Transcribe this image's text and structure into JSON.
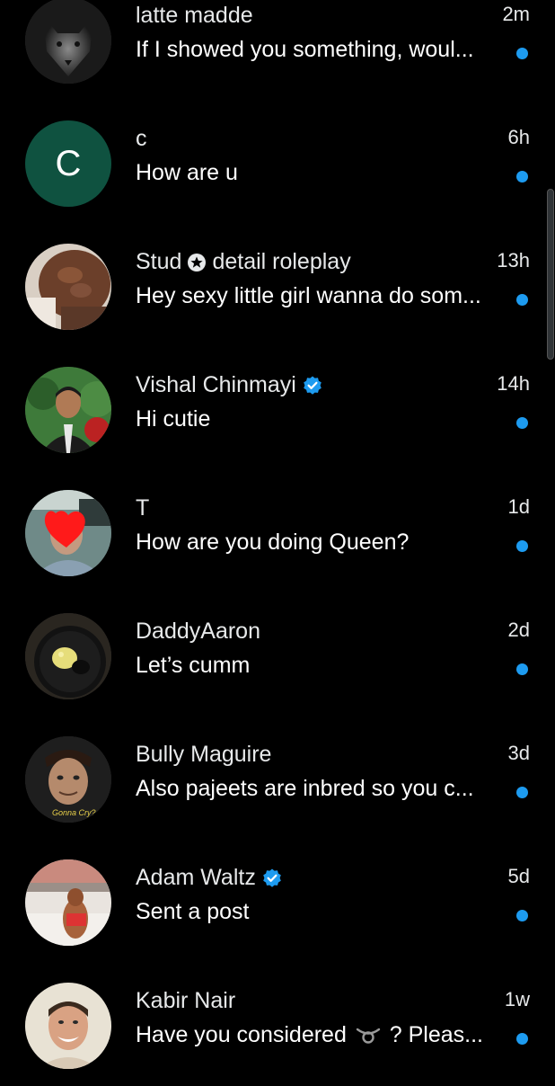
{
  "conversations": [
    {
      "name": "latte madde",
      "time": "2m",
      "preview": "If I showed you something, woul...",
      "avatar": "wolf-avatar",
      "unread": true
    },
    {
      "name": "c",
      "time": "6h",
      "preview": "How are u",
      "avatar_initial": "C",
      "avatar_color": "#0f5240",
      "unread": true
    },
    {
      "name_before": "Stud",
      "name_after": "detail roleplay",
      "time": "13h",
      "preview": "Hey sexy little girl wanna do som...",
      "avatar": "torso-photo-avatar",
      "badge_icon": "star-circle-icon",
      "unread": true
    },
    {
      "name": "Vishal Chinmayi",
      "time": "14h",
      "preview": "Hi cutie",
      "avatar": "man-in-suit-avatar",
      "verified": true,
      "unread": true
    },
    {
      "name": "T",
      "time": "1d",
      "preview": "How are you doing Queen?",
      "avatar": "face-censored-avatar",
      "unread": true
    },
    {
      "name": "DaddyAaron",
      "time": "2d",
      "preview": "Let’s cumm",
      "avatar": "pan-food-avatar",
      "unread": true
    },
    {
      "name": "Bully Maguire",
      "time": "3d",
      "preview": "Also pajeets are inbred so you c...",
      "avatar": "meme-face-avatar",
      "avatar_caption": "Gonna Cry?",
      "unread": true
    },
    {
      "name": "Adam Waltz",
      "time": "5d",
      "preview": "Sent a post",
      "avatar": "pool-photo-avatar",
      "verified": true,
      "unread": true
    },
    {
      "name": "Kabir Nair",
      "time": "1w",
      "preview_before": "Have you considered",
      "preview_icon": "ouroboros-symbol",
      "preview_after": "? Pleas...",
      "avatar": "smiling-man-avatar",
      "unread": true
    }
  ],
  "colors": {
    "background": "#000000",
    "text_primary": "#e7e9ea",
    "unread_dot": "#1d9bf0",
    "verified": "#1d9bf0"
  }
}
